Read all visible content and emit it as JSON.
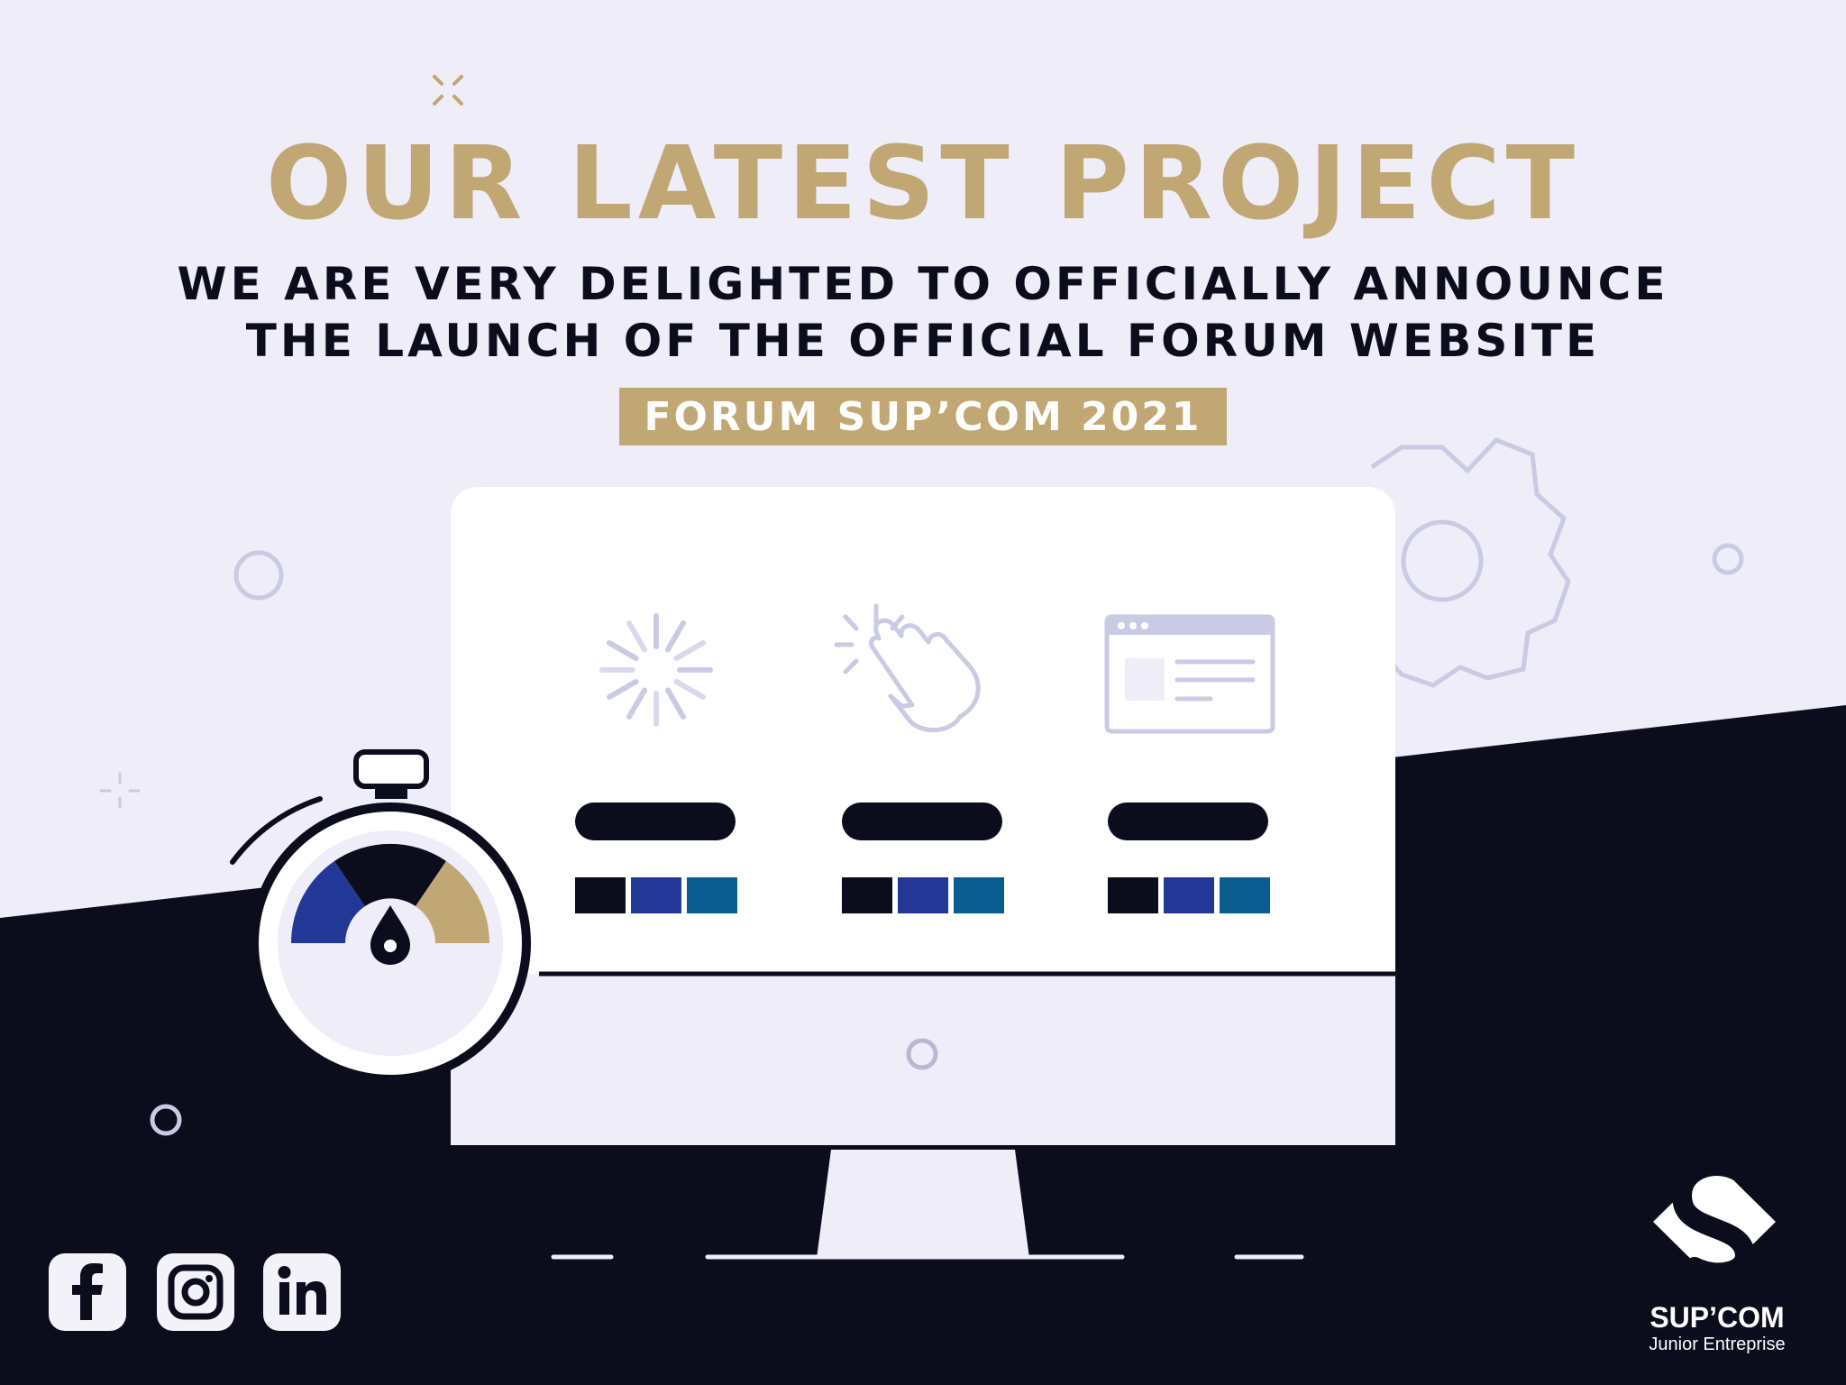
{
  "header": {
    "title": "OUR LATEST PROJECT",
    "subtitle_line1": "WE ARE VERY DELIGHTED TO OFFICIALLY ANNOUNCE",
    "subtitle_line2": "THE LAUNCH OF THE OFFICIAL FORUM WEBSITE",
    "badge": "FORUM SUP’COM 2021"
  },
  "colors": {
    "gold": "#c1a773",
    "navy": "#0b0c1c",
    "background": "#eeedf8",
    "swatch_1": "#0b0c1c",
    "swatch_2": "#233797",
    "swatch_3": "#0b5d91"
  },
  "monitor": {
    "features": [
      {
        "icon": "loading-spinner-icon"
      },
      {
        "icon": "click-hand-icon"
      },
      {
        "icon": "browser-window-icon"
      }
    ]
  },
  "social": [
    {
      "icon": "facebook-icon"
    },
    {
      "icon": "instagram-icon"
    },
    {
      "icon": "linkedin-icon"
    }
  ],
  "brand": {
    "name": "SUP’COM",
    "tagline": "Junior Entreprise"
  }
}
